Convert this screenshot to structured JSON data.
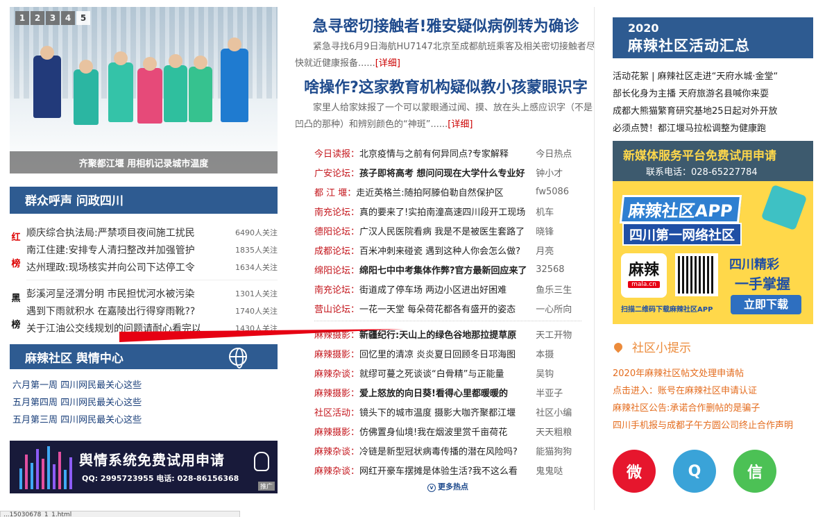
{
  "slider": {
    "numbers": [
      "1",
      "2",
      "3",
      "4",
      "5"
    ],
    "active_index": 5,
    "caption": "齐聚都江堰 用相机记录城市温度"
  },
  "people_voice": {
    "title": "群众呼声 问政四川",
    "red_tag": [
      "红",
      "榜"
    ],
    "black_tag": [
      "黑",
      "榜"
    ],
    "red_list": [
      {
        "title": "顺庆综合执法局:严禁项目夜间施工扰民",
        "count": "6490人关注"
      },
      {
        "title": "南江住建:安排专人清扫整改并加强管护",
        "count": "1835人关注"
      },
      {
        "title": "达州理政:现场核实并向公司下达停工令",
        "count": "1634人关注"
      }
    ],
    "black_list": [
      {
        "title": "彭溪河呈泾渭分明 市民担忧河水被污染",
        "count": "1301人关注"
      },
      {
        "title": "遇到下雨就积水 在嘉陵出行得穿雨靴??",
        "count": "1740人关注"
      },
      {
        "title": "关于江油公交线规划的问题请耐心看完以",
        "count": "1430人关注"
      }
    ]
  },
  "opinion_center": {
    "title": "麻辣社区 舆情中心",
    "items": [
      "六月第一周 四川网民最关心这些",
      "五月第四周 四川网民最关心这些",
      "五月第三周 四川网民最关心这些"
    ]
  },
  "ad_left": {
    "title": "舆情系统免费试用申请",
    "contact": "QQ: 2995723955  电话: 028-86156368",
    "badge": "推广"
  },
  "headlines": [
    {
      "title": "急寻密切接触者!雅安疑似病例转为确诊",
      "summary": "紧急寻找6月9日海航HU7147北京至成都航班乘客及相关密切接触者尽快就近健康报备......",
      "more": "[详细]"
    },
    {
      "title": "啥操作?这家教育机构疑似教小孩蒙眼识字",
      "summary": "家里人给家妹报了一个可以蒙眼通过闻、摸、放在头上感应识字（不是凹凸的那种）和辨别颜色的“神斑”......",
      "more": "[详细]"
    }
  ],
  "news": {
    "group1": [
      {
        "cat": "今日读报：",
        "title": "北京疫情与之前有何异同点?专家解释",
        "author": "今日热点",
        "bold": false
      },
      {
        "cat": "广安论坛：",
        "title": "孩子即将高考 想问问现在大学什么专业好",
        "author": "钟小才",
        "bold": true
      },
      {
        "cat": "都 江 堰：",
        "title": "走近英格兰:随拍阿滕伯勒自然保护区",
        "author": "fw5086",
        "bold": false
      },
      {
        "cat": "南充论坛：",
        "title": "真的要来了!实拍南潼高速四川段开工现场",
        "author": "机车",
        "bold": false
      },
      {
        "cat": "德阳论坛：",
        "title": "广汉人民医院看病 我是不是被医生套路了",
        "author": "晓锋",
        "bold": false
      },
      {
        "cat": "成都论坛：",
        "title": "百米冲刺来碰瓷 遇到这种人你会怎么做?",
        "author": "月亮",
        "bold": false
      },
      {
        "cat": "绵阳论坛：",
        "title": "绵阳七中中考集体作弊?官方最新回应来了",
        "author": "32568",
        "bold": true
      },
      {
        "cat": "南充论坛：",
        "title": "街道成了停车场 两边小区进出好困难",
        "author": "鱼乐三生",
        "bold": false
      },
      {
        "cat": "营山论坛：",
        "title": "一花一天堂 每朵荷花都各有盛开的姿态",
        "author": "一心所向",
        "bold": false
      }
    ],
    "group2": [
      {
        "cat": "麻辣摄影：",
        "title": "新疆纪行:天山上的绿色谷地那拉提草原",
        "author": "天工开物",
        "bold": true
      },
      {
        "cat": "麻辣摄影：",
        "title": "回忆里的清凉 炎炎夏日回顾冬日邛海图",
        "author": "本摄",
        "bold": false
      },
      {
        "cat": "麻辣杂谈：",
        "title": "就缪可蔓之死谈谈“白骨精”与正能量",
        "author": "吴钩",
        "bold": false
      },
      {
        "cat": "麻辣摄影：",
        "title": "爱上怒放的向日葵!看得心里都暖暖的",
        "author": "半亚子",
        "bold": true
      },
      {
        "cat": "社区活动：",
        "title": "镜头下的城市温度 摄影大咖齐聚都江堰",
        "author": "社区小编",
        "bold": false
      },
      {
        "cat": "麻辣摄影：",
        "title": "仿佛置身仙境!我在烟波里赏千亩荷花",
        "author": "天天粗粮",
        "bold": false
      },
      {
        "cat": "麻辣杂谈：",
        "title": "冷链是新型冠状病毒传播的潜在风险吗?",
        "author": "能猫狗狗",
        "bold": false
      },
      {
        "cat": "麻辣杂谈：",
        "title": "网红开豪车摆摊是体验生活?我不这么看",
        "author": "鬼鬼哒",
        "bold": false
      }
    ],
    "more_label": "更多热点"
  },
  "activity": {
    "year": "2020",
    "title": "麻辣社区活动汇总",
    "items": [
      "活动花絮 | 麻辣社区走进“天府水城·金堂“",
      "部长化身为主播 天府旅游名县喊你来耍",
      "成都大熊猫繁育研究基地25日起对外开放",
      "必须点赞！都江堰马拉松调整为健康跑"
    ]
  },
  "ad_media": {
    "title": "新媒体服务平台免费试用申请",
    "phone": "联系电话：028-65227784"
  },
  "ad_app": {
    "line1": "麻辣社区APP",
    "line2": "四川第一网络社区",
    "logo_text": "麻辣",
    "logo_domain": "mala.cn",
    "slogan1": "四川精彩",
    "slogan2": "一手掌握",
    "button": "立即下载",
    "scan": "扫描二维码下载麻辣社区APP"
  },
  "tips": {
    "title": "社区小提示",
    "items": [
      "2020年麻辣社区帖文处理申请帖",
      "点击进入：账号在麻辣社区申请认证",
      "麻辣社区公告:承诺合作删帖的是骗子",
      "四川手机报与成都子午方圆公司终止合作声明"
    ]
  },
  "social": {
    "weibo": "微",
    "qq": "Q",
    "wechat": "信"
  },
  "status": "...15030678_1_1.html",
  "colors": {
    "brand_blue": "#2e5b91",
    "category_red": "#c4161c",
    "tips_orange": "#e46c1e"
  }
}
